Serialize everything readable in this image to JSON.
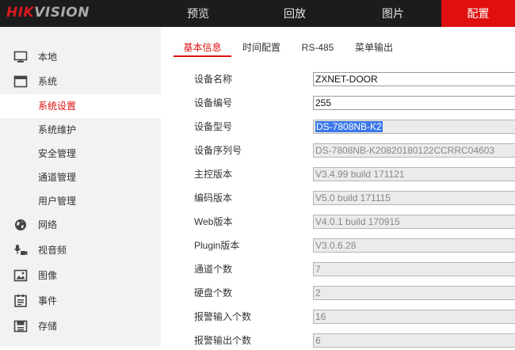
{
  "brand": {
    "hik": "HIK",
    "vision": "VISION"
  },
  "nav": {
    "preview": "预览",
    "playback": "回放",
    "picture": "图片",
    "config": "配置"
  },
  "sidebar": {
    "local": "本地",
    "system": "系统",
    "system_settings": "系统设置",
    "system_maintenance": "系统维护",
    "security": "安全管理",
    "channel": "通道管理",
    "user": "用户管理",
    "network": "网络",
    "av": "视音频",
    "image": "图像",
    "event": "事件",
    "storage": "存储"
  },
  "tabs": {
    "basic": "基本信息",
    "time": "时间配置",
    "rs485": "RS-485",
    "menu_output": "菜单输出"
  },
  "form": [
    {
      "label": "设备名称",
      "value": "ZXNET-DOOR"
    },
    {
      "label": "设备编号",
      "value": "255"
    },
    {
      "label": "设备型号",
      "value": "DS-7808NB-K2"
    },
    {
      "label": "设备序列号",
      "value": "DS-7808NB-K20820180122CCRRC04603"
    },
    {
      "label": "主控版本",
      "value": "V3.4.99 build 171121"
    },
    {
      "label": "编码版本",
      "value": "V5.0 build 171115"
    },
    {
      "label": "Web版本",
      "value": "V4.0.1 build 170915"
    },
    {
      "label": "Plugin版本",
      "value": "V3.0.6.28"
    },
    {
      "label": "通道个数",
      "value": "7"
    },
    {
      "label": "硬盘个数",
      "value": "2"
    },
    {
      "label": "报警输入个数",
      "value": "16"
    },
    {
      "label": "报警输出个数",
      "value": "6"
    }
  ],
  "colors": {
    "accent": "#e01010",
    "topbar": "#1c1c1c",
    "sidebar": "#f2f2f2",
    "selection": "#3b78e7"
  }
}
